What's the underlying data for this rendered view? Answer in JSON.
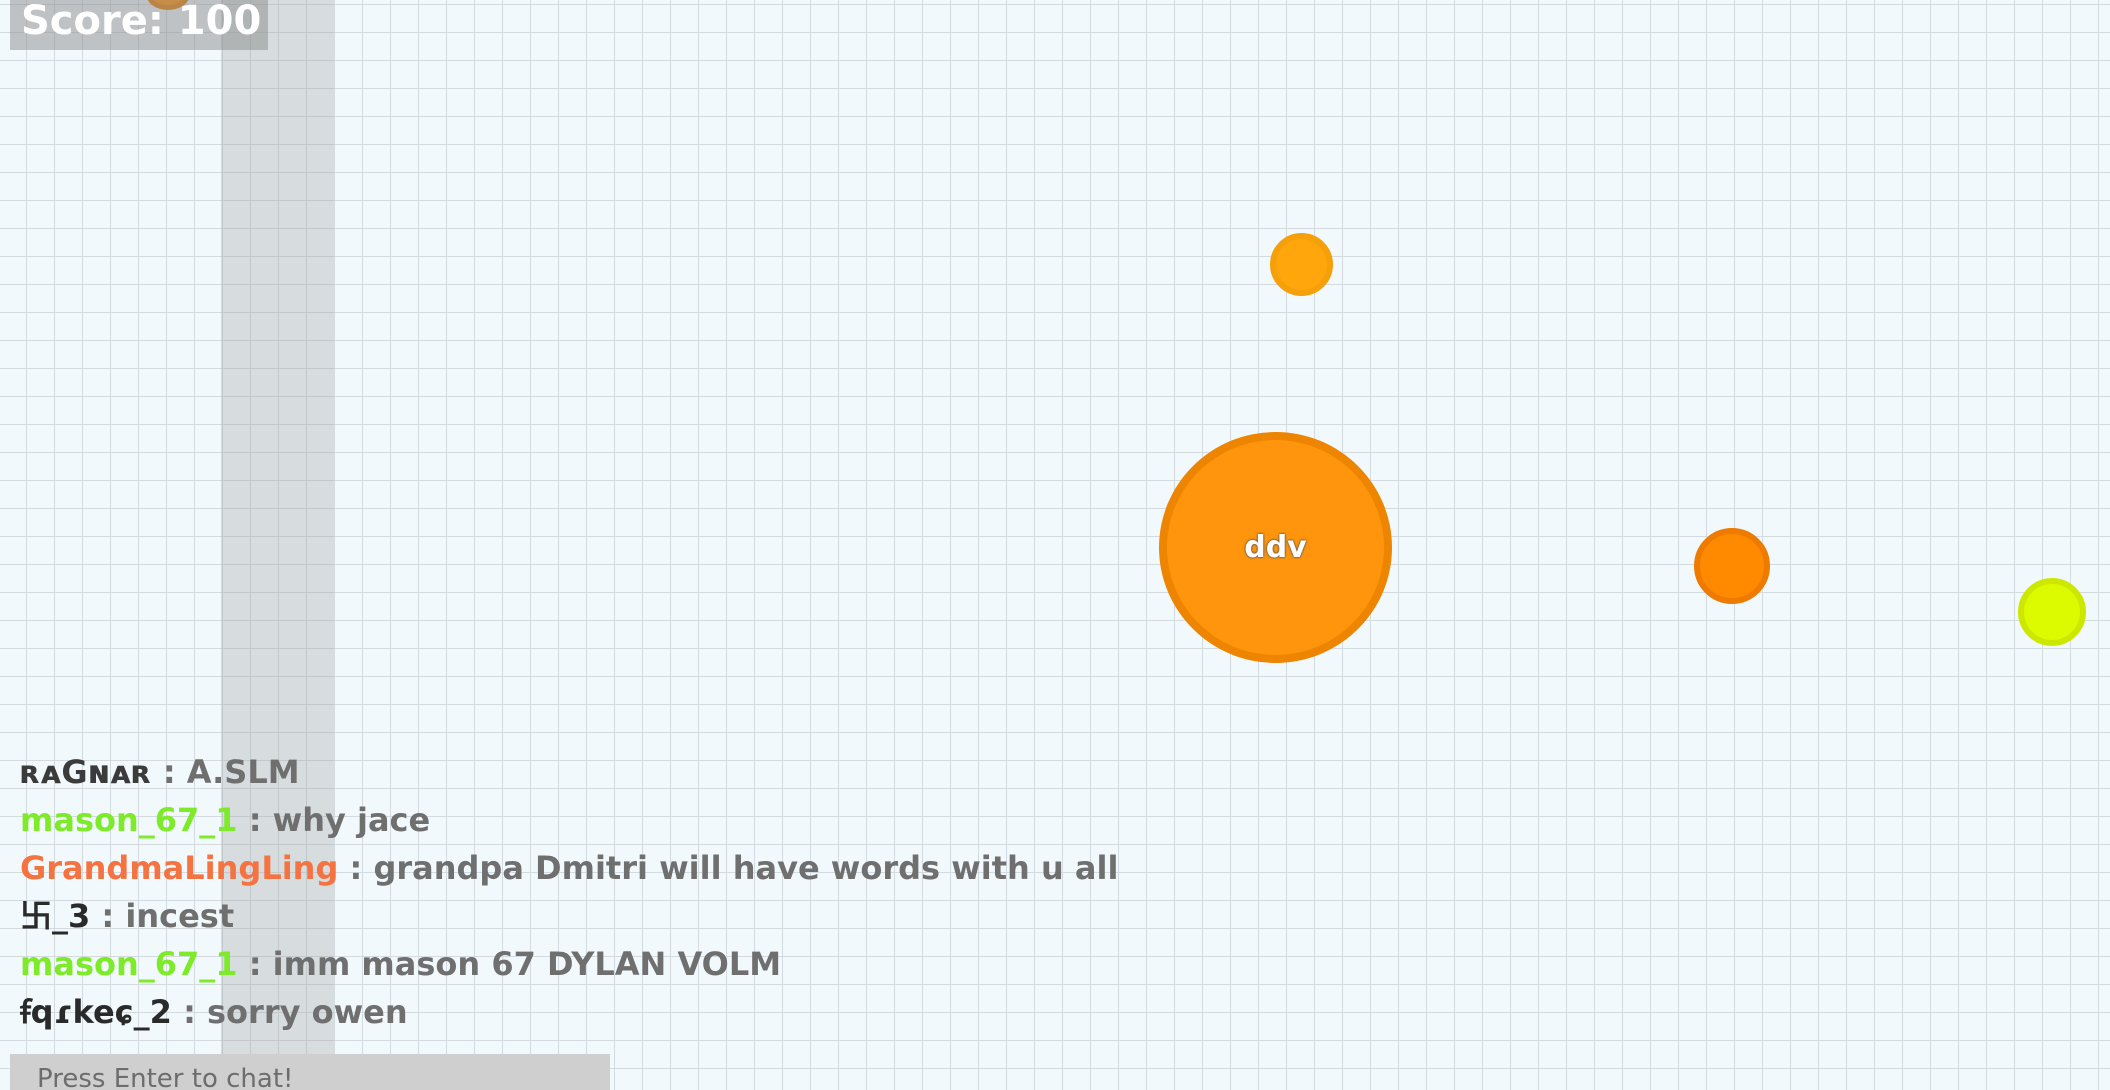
{
  "hud": {
    "score_text": "Score: 100"
  },
  "player": {
    "name": "ddv",
    "color": "#ff950c"
  },
  "chat": {
    "messages": [
      {
        "user": "ʀᴀGɴᴀʀ",
        "sep": " : ",
        "text": "A.SLM",
        "user_color": "#3b3b3b"
      },
      {
        "user": "mason_67_1",
        "sep": " : ",
        "text": "why jace",
        "user_color": "#7dea2a"
      },
      {
        "user": "GrandmaLingLing",
        "sep": " : ",
        "text": "grandpa Dmitri will have words with u all",
        "user_color": "#f47340"
      },
      {
        "user": "卐_3",
        "sep": " : ",
        "text": "incest",
        "user_color": "#2a2a2a"
      },
      {
        "user": "mason_67_1",
        "sep": " : ",
        "text": "imm mason 67 DYLAN VOLM",
        "user_color": "#7dea2a"
      },
      {
        "user": "ꞙqɾkeɕ_2",
        "sep": " : ",
        "text": "sorry owen",
        "user_color": "#2a2a2a"
      }
    ],
    "input_placeholder": "Press Enter to chat!"
  },
  "colors": {
    "background": "#f2f9fc",
    "grid": "#d4dbe0",
    "food_orange": "#ffa60c",
    "food_dark_orange": "#ff8a00",
    "food_lime": "#dcfa00"
  }
}
